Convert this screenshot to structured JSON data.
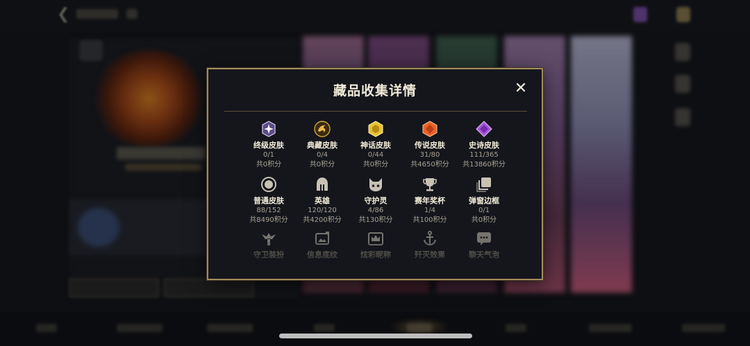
{
  "modal": {
    "title": "藏品收集详情",
    "close_icon": "close-icon",
    "rows": [
      [
        {
          "name": "终级皮肤",
          "count": "0/1",
          "points": "共0积分",
          "icon": "crystal-star-icon",
          "color": "#b9a6e0"
        },
        {
          "name": "典藏皮肤",
          "count": "0/4",
          "points": "共0积分",
          "icon": "dragon-emblem-icon",
          "color": "#d3a33a"
        },
        {
          "name": "神话皮肤",
          "count": "0/44",
          "points": "共0积分",
          "icon": "gold-hexagon-gem-icon",
          "color": "#e8c231"
        },
        {
          "name": "传说皮肤",
          "count": "31/80",
          "points": "共4650积分",
          "icon": "orange-hexagon-gem-icon",
          "color": "#e8642a"
        },
        {
          "name": "史诗皮肤",
          "count": "111/365",
          "points": "共13860积分",
          "icon": "purple-diamond-gem-icon",
          "color": "#a656d8"
        }
      ],
      [
        {
          "name": "普通皮肤",
          "count": "88/152",
          "points": "共8490积分",
          "icon": "round-gem-icon",
          "color": "#c8c2b4"
        },
        {
          "name": "英雄",
          "count": "120/120",
          "points": "共4200积分",
          "icon": "helmet-icon",
          "color": "#c8c2b4"
        },
        {
          "name": "守护灵",
          "count": "4/86",
          "points": "共130积分",
          "icon": "spirit-cat-icon",
          "color": "#c8c2b4"
        },
        {
          "name": "赛年奖杯",
          "count": "1/4",
          "points": "共100积分",
          "icon": "trophy-icon",
          "color": "#c8c2b4"
        },
        {
          "name": "弹窗边框",
          "count": "0/1",
          "points": "共0积分",
          "icon": "stacked-frames-icon",
          "color": "#c8c2b4"
        }
      ],
      [
        {
          "name": "守卫装扮",
          "icon": "ward-icon",
          "color": "#c8c2b4"
        },
        {
          "name": "信息底纹",
          "icon": "info-card-icon",
          "color": "#c8c2b4"
        },
        {
          "name": "炫彩昵称",
          "icon": "crown-nameplate-icon",
          "color": "#c8c2b4"
        },
        {
          "name": "歼灭效果",
          "icon": "anchor-icon",
          "color": "#c8c2b4"
        },
        {
          "name": "聊天气泡",
          "icon": "chat-bubble-icon",
          "color": "#c8c2b4"
        }
      ]
    ]
  }
}
